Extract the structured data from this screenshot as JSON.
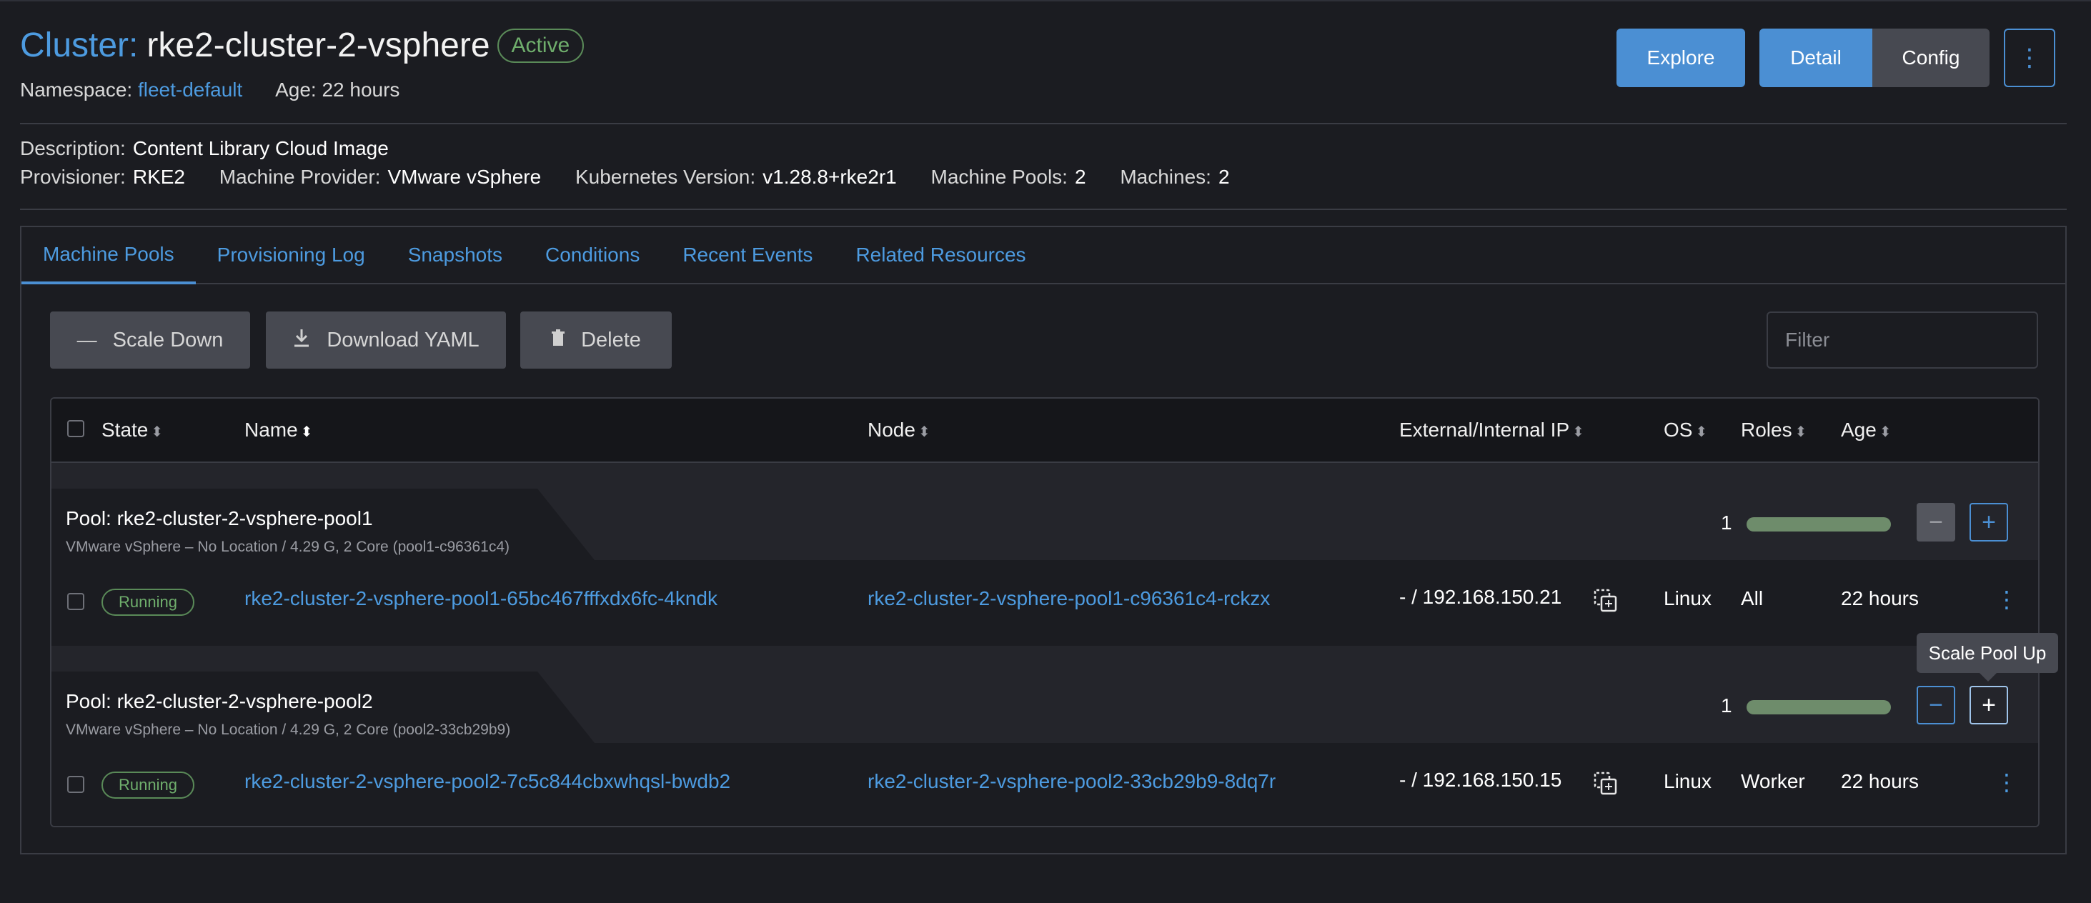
{
  "header": {
    "title_prefix": "Cluster:",
    "cluster_name": "rke2-cluster-2-vsphere",
    "state": "Active",
    "namespace_label": "Namespace:",
    "namespace": "fleet-default",
    "age_label": "Age:",
    "age": "22 hours",
    "buttons": {
      "explore": "Explore",
      "detail": "Detail",
      "config": "Config"
    }
  },
  "details": {
    "description_label": "Description:",
    "description": "Content Library Cloud Image",
    "provisioner_label": "Provisioner:",
    "provisioner": "RKE2",
    "machine_provider_label": "Machine Provider:",
    "machine_provider": "VMware vSphere",
    "k8s_version_label": "Kubernetes Version:",
    "k8s_version": "v1.28.8+rke2r1",
    "machine_pools_label": "Machine Pools:",
    "machine_pools": "2",
    "machines_label": "Machines:",
    "machines": "2"
  },
  "tabs": [
    {
      "label": "Machine Pools",
      "active": true
    },
    {
      "label": "Provisioning Log"
    },
    {
      "label": "Snapshots"
    },
    {
      "label": "Conditions"
    },
    {
      "label": "Recent Events"
    },
    {
      "label": "Related Resources"
    }
  ],
  "actions": {
    "scale_down": "Scale Down",
    "download_yaml": "Download YAML",
    "delete": "Delete",
    "filter_placeholder": "Filter"
  },
  "table": {
    "columns": {
      "state": "State",
      "name": "Name",
      "node": "Node",
      "ip": "External/Internal IP",
      "os": "OS",
      "roles": "Roles",
      "age": "Age"
    },
    "pools": [
      {
        "title": "Pool: rke2-cluster-2-vsphere-pool1",
        "subtitle": "VMware vSphere – No Location / 4.29 G, 2 Core (pool1-c96361c4)",
        "count": "1",
        "machines": [
          {
            "state": "Running",
            "name": "rke2-cluster-2-vsphere-pool1-65bc467fffxdx6fc-4kndk",
            "node": "rke2-cluster-2-vsphere-pool1-c96361c4-rckzx",
            "ip": "- / 192.168.150.21",
            "os": "Linux",
            "roles": "All",
            "age": "22 hours"
          }
        ]
      },
      {
        "title": "Pool: rke2-cluster-2-vsphere-pool2",
        "subtitle": "VMware vSphere – No Location / 4.29 G, 2 Core (pool2-33cb29b9)",
        "count": "1",
        "machines": [
          {
            "state": "Running",
            "name": "rke2-cluster-2-vsphere-pool2-7c5c844cbxwhqsl-bwdb2",
            "node": "rke2-cluster-2-vsphere-pool2-33cb29b9-8dq7r",
            "ip": "- / 192.168.150.15",
            "os": "Linux",
            "roles": "Worker",
            "age": "22 hours"
          }
        ]
      }
    ]
  },
  "tooltip": "Scale Pool Up",
  "colors": {
    "accent": "#4b8fd3",
    "active_green": "#6fae6c",
    "background": "#1b1c21"
  }
}
